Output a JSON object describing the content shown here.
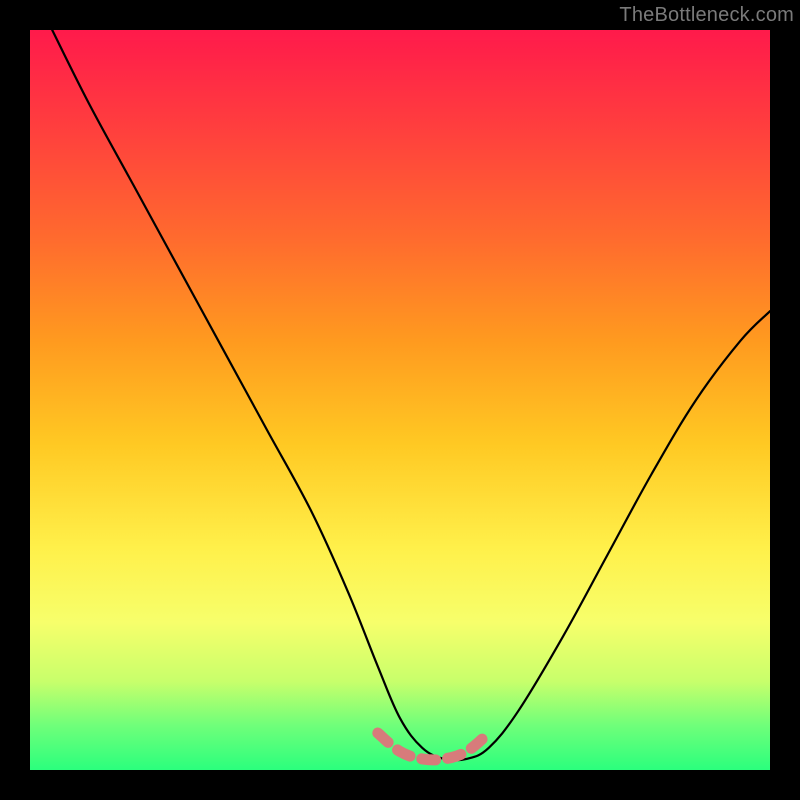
{
  "watermark": "TheBottleneck.com",
  "chart_data": {
    "type": "line",
    "title": "",
    "xlabel": "",
    "ylabel": "",
    "xlim": [
      0,
      100
    ],
    "ylim": [
      0,
      100
    ],
    "grid": false,
    "legend": false,
    "series": [
      {
        "name": "bottleneck-curve",
        "color": "#000000",
        "x": [
          3,
          8,
          14,
          20,
          26,
          32,
          38,
          43,
          47,
          50,
          53,
          56,
          59,
          62,
          66,
          72,
          78,
          84,
          90,
          96,
          100
        ],
        "y": [
          100,
          90,
          79,
          68,
          57,
          46,
          35,
          24,
          14,
          7,
          3,
          1.5,
          1.5,
          3,
          8,
          18,
          29,
          40,
          50,
          58,
          62
        ]
      },
      {
        "name": "optimal-zone-marker",
        "color": "#d77b7b",
        "x": [
          47,
          50,
          53,
          56,
          59,
          62
        ],
        "y": [
          5,
          2.5,
          1.5,
          1.5,
          2.5,
          5
        ]
      }
    ],
    "gradient_stops": [
      {
        "pos": 0,
        "color": "#ff1a4b"
      },
      {
        "pos": 12,
        "color": "#ff3b3f"
      },
      {
        "pos": 28,
        "color": "#ff6a2e"
      },
      {
        "pos": 42,
        "color": "#ff9a1f"
      },
      {
        "pos": 56,
        "color": "#ffc923"
      },
      {
        "pos": 70,
        "color": "#fff04a"
      },
      {
        "pos": 80,
        "color": "#f7ff6b"
      },
      {
        "pos": 88,
        "color": "#c8ff6b"
      },
      {
        "pos": 94,
        "color": "#6fff7a"
      },
      {
        "pos": 100,
        "color": "#2bff7d"
      }
    ]
  }
}
